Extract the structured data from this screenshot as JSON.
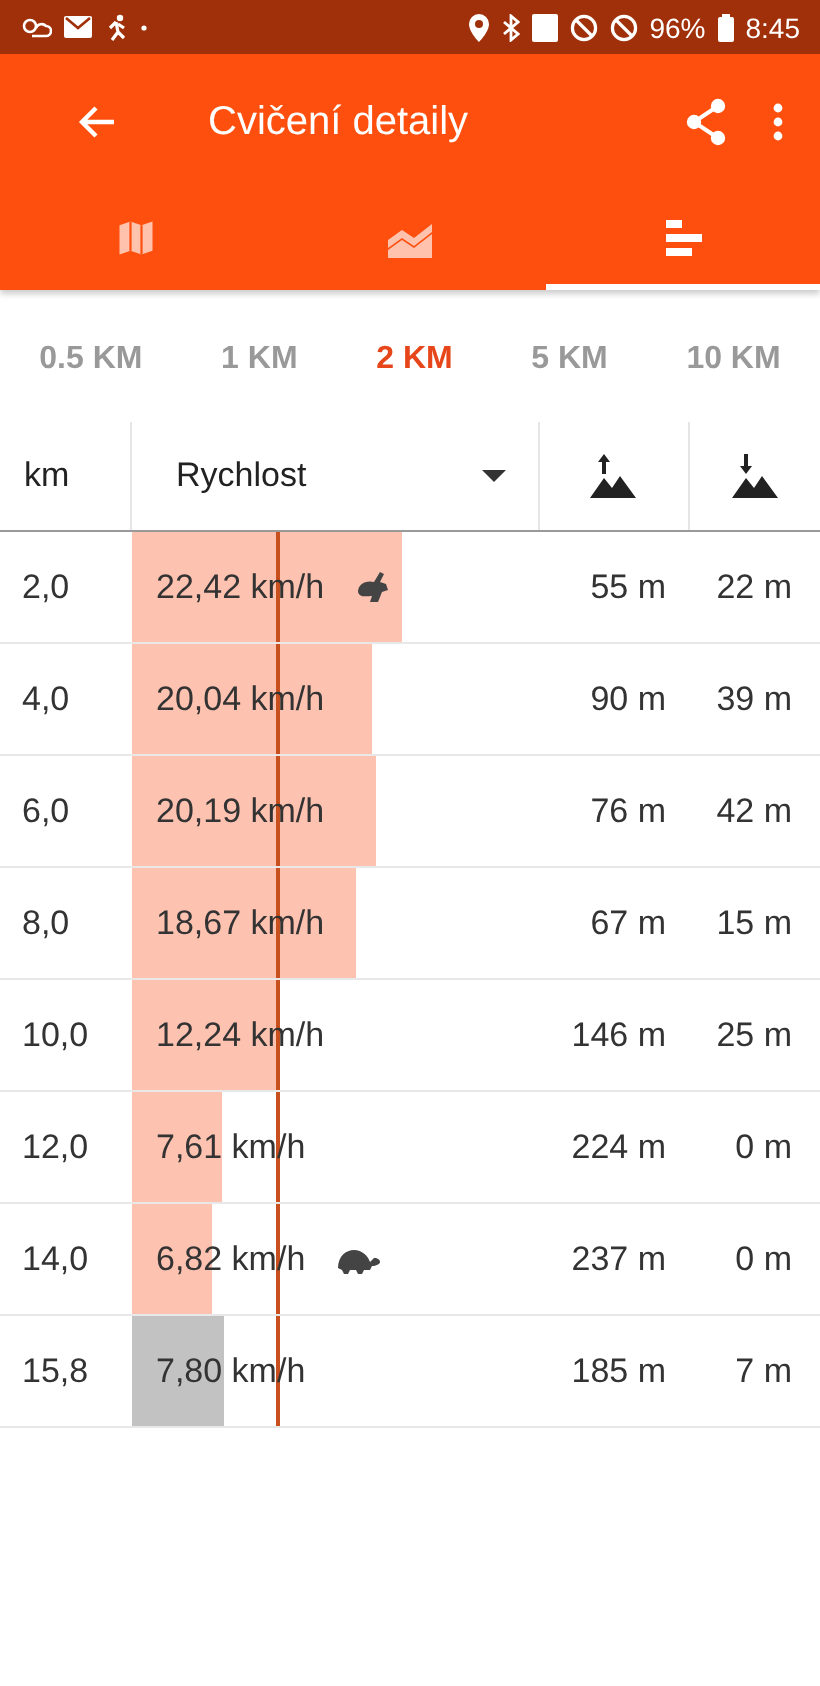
{
  "status_bar": {
    "battery": "96%",
    "time": "8:45"
  },
  "app_bar": {
    "title": "Cvičení detaily"
  },
  "tabs": [
    {
      "selected": false
    },
    {
      "selected": false
    },
    {
      "selected": true
    }
  ],
  "intervals": [
    {
      "label": "0.5 KM",
      "selected": false
    },
    {
      "label": "1 KM",
      "selected": false
    },
    {
      "label": "2 KM",
      "selected": true
    },
    {
      "label": "5 KM",
      "selected": false
    },
    {
      "label": "10 KM",
      "selected": false
    }
  ],
  "table": {
    "columns": {
      "distance": "km",
      "metric": "Rychlost"
    },
    "average_marker": {
      "level": 0.353
    },
    "rows": [
      {
        "kind": "fastest",
        "km": "2,0",
        "speed": "22,42 km/h",
        "incomplete": false,
        "ascent": "55 m",
        "descent": "22 m"
      },
      {
        "kind": "plain",
        "km": "4,0",
        "speed": "20,04 km/h",
        "incomplete": false,
        "ascent": "90 m",
        "descent": "39 m"
      },
      {
        "kind": "plain",
        "km": "6,0",
        "speed": "20,19 km/h",
        "incomplete": false,
        "ascent": "76 m",
        "descent": "42 m"
      },
      {
        "kind": "plain",
        "km": "8,0",
        "speed": "18,67 km/h",
        "incomplete": false,
        "ascent": "67 m",
        "descent": "15 m"
      },
      {
        "kind": "plain",
        "km": "10,0",
        "speed": "12,24 km/h",
        "incomplete": false,
        "ascent": "146 m",
        "descent": "25 m"
      },
      {
        "kind": "plain",
        "km": "12,0",
        "speed": "7,61 km/h",
        "incomplete": false,
        "ascent": "224 m",
        "descent": "0 m"
      },
      {
        "kind": "slowest",
        "km": "14,0",
        "speed": "6,82 km/h",
        "incomplete": false,
        "ascent": "237 m",
        "descent": "0 m"
      },
      {
        "kind": "plain",
        "km": "15,8",
        "speed": "7,80 km/h",
        "incomplete": true,
        "ascent": "185 m",
        "descent": "7 m"
      }
    ]
  }
}
